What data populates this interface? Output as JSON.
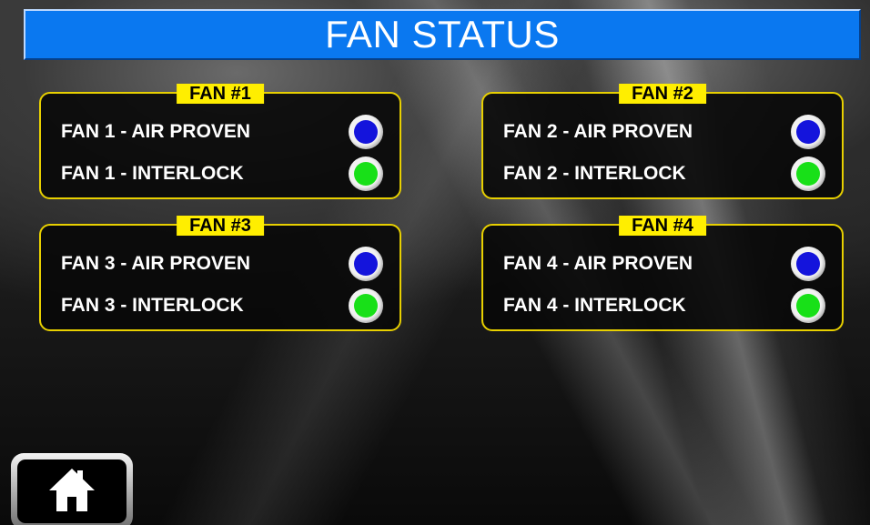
{
  "header": {
    "title": "FAN STATUS"
  },
  "colors": {
    "title_bar": "#0a78f0",
    "panel_border": "#e8d000",
    "tag_background": "#ffee00",
    "air_proven_indicator": "#1414dc",
    "interlock_indicator": "#18e018"
  },
  "fans": [
    {
      "tag": "FAN #1",
      "rows": [
        {
          "label": "FAN 1 - AIR PROVEN",
          "indicator": "blue"
        },
        {
          "label": "FAN 1 - INTERLOCK",
          "indicator": "green"
        }
      ]
    },
    {
      "tag": "FAN #2",
      "rows": [
        {
          "label": "FAN 2 - AIR PROVEN",
          "indicator": "blue"
        },
        {
          "label": "FAN 2 - INTERLOCK",
          "indicator": "green"
        }
      ]
    },
    {
      "tag": "FAN #3",
      "rows": [
        {
          "label": "FAN 3 - AIR PROVEN",
          "indicator": "blue"
        },
        {
          "label": "FAN 3 - INTERLOCK",
          "indicator": "green"
        }
      ]
    },
    {
      "tag": "FAN #4",
      "rows": [
        {
          "label": "FAN 4 - AIR PROVEN",
          "indicator": "blue"
        },
        {
          "label": "FAN 4 - INTERLOCK",
          "indicator": "green"
        }
      ]
    }
  ],
  "footer": {
    "home_icon": "home-icon"
  }
}
